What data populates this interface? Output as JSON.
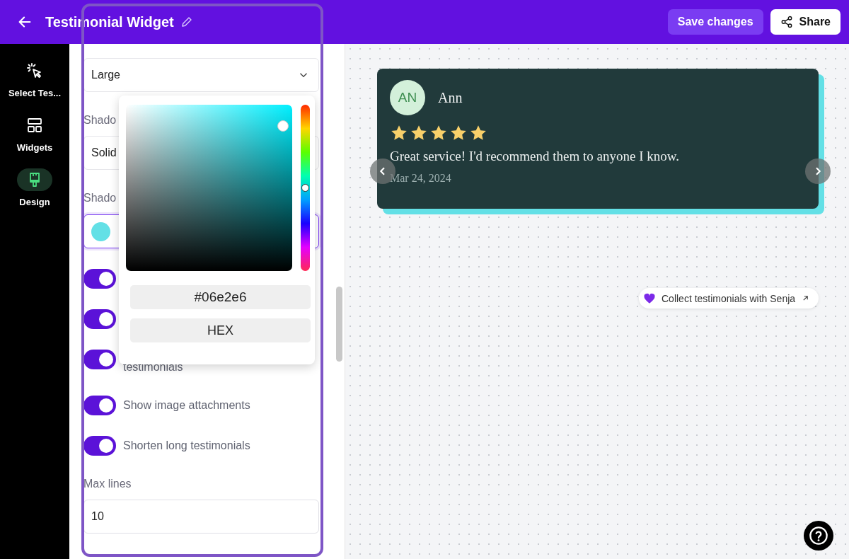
{
  "header": {
    "title": "Testimonial Widget",
    "buttons": [
      {
        "label": "Save changes",
        "kind": "primary"
      },
      {
        "label": "Share",
        "kind": "share"
      }
    ]
  },
  "nav": {
    "items": [
      {
        "label": "Select Tes...",
        "kind": "cursor",
        "selected": false
      },
      {
        "label": "Widgets",
        "kind": "layout",
        "selected": false
      },
      {
        "label": "Design",
        "kind": "brush",
        "selected": true
      }
    ]
  },
  "settings": {
    "shadow_size": {
      "value": "Large"
    },
    "shadow_style_label": "Shado",
    "shadow_style": {
      "value": "Solid"
    },
    "shadow_color_label": "Shado",
    "shadow_color": {
      "color": "#63e0e6"
    },
    "toggles": [
      {
        "on": true
      },
      {
        "on": true
      },
      {
        "on": true,
        "kind": "wrapped",
        "label": "testimonials"
      },
      {
        "on": true,
        "label": "Show image attachments"
      },
      {
        "on": true,
        "label": "Shorten long testimonials"
      }
    ],
    "max_lines": {
      "label": "Max lines",
      "value": "10"
    }
  },
  "color_picker": {
    "hex": "#06e2e6",
    "format": "HEX",
    "hue": {
      "level": 0.5
    }
  },
  "preview": {
    "card": {
      "initials": "AN",
      "name": "Ann",
      "stars": 5,
      "text": "Great service! I'd recommend them to anyone I know.",
      "date": "Mar 24, 2024"
    },
    "badge": "Collect testimonials with Senja"
  }
}
